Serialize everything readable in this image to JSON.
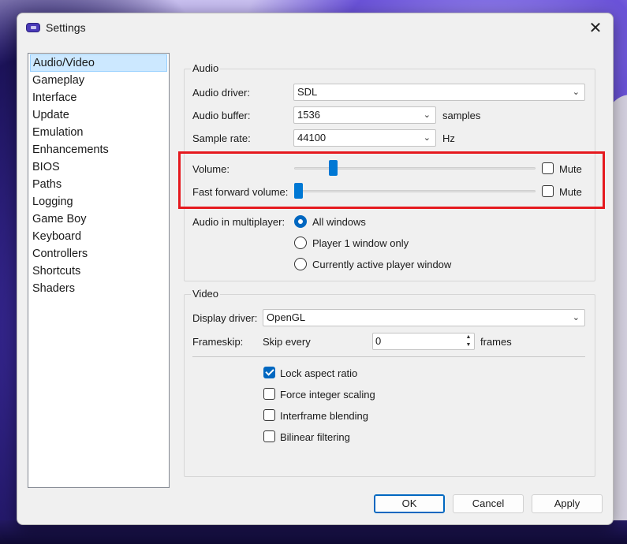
{
  "window": {
    "title": "Settings",
    "close_glyph": "✕"
  },
  "sidebar": {
    "items": [
      {
        "label": "Audio/Video",
        "selected": true
      },
      {
        "label": "Gameplay"
      },
      {
        "label": "Interface"
      },
      {
        "label": "Update"
      },
      {
        "label": "Emulation"
      },
      {
        "label": "Enhancements"
      },
      {
        "label": "BIOS"
      },
      {
        "label": "Paths"
      },
      {
        "label": "Logging"
      },
      {
        "label": "Game Boy"
      },
      {
        "label": "Keyboard"
      },
      {
        "label": "Controllers"
      },
      {
        "label": "Shortcuts"
      },
      {
        "label": "Shaders"
      }
    ]
  },
  "audio": {
    "group_title": "Audio",
    "driver_label": "Audio driver:",
    "driver_value": "SDL",
    "buffer_label": "Audio buffer:",
    "buffer_value": "1536",
    "buffer_unit": "samples",
    "rate_label": "Sample rate:",
    "rate_value": "44100",
    "rate_unit": "Hz",
    "volume_label": "Volume:",
    "volume_level": 0.15,
    "volume_mute_label": "Mute",
    "ff_volume_label": "Fast forward volume:",
    "ff_volume_level": 0.0,
    "ff_mute_label": "Mute",
    "multiplayer_label": "Audio in multiplayer:",
    "multiplayer_options": [
      "All windows",
      "Player 1 window only",
      "Currently active player window"
    ],
    "multiplayer_selected": "All windows"
  },
  "video": {
    "group_title": "Video",
    "display_driver_label": "Display driver:",
    "display_driver_value": "OpenGL",
    "frameskip_label": "Frameskip:",
    "skip_every_label": "Skip every",
    "frameskip_value": "0",
    "frames_unit": "frames",
    "options": [
      {
        "label": "Lock aspect ratio",
        "checked": true
      },
      {
        "label": "Force integer scaling",
        "checked": false
      },
      {
        "label": "Interframe blending",
        "checked": false
      },
      {
        "label": "Bilinear filtering",
        "checked": false
      }
    ]
  },
  "buttons": {
    "ok": "OK",
    "cancel": "Cancel",
    "apply": "Apply"
  },
  "colors": {
    "accent": "#0067c0",
    "highlight_box": "#e5191e",
    "selection": "#cce8ff"
  }
}
